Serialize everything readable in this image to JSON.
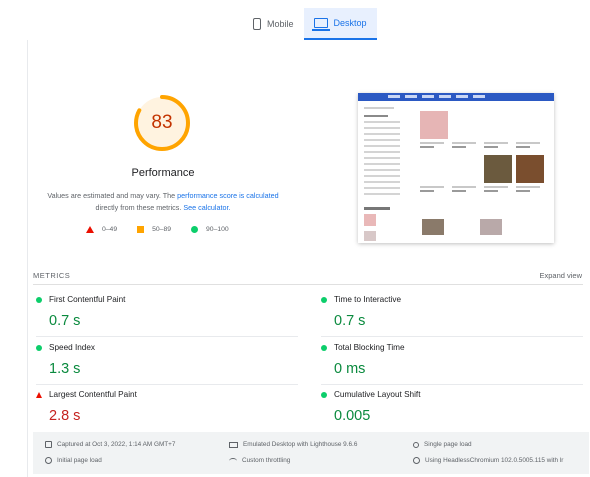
{
  "tabs": [
    {
      "label": "Mobile",
      "icon": "mobile-icon",
      "active": false
    },
    {
      "label": "Desktop",
      "icon": "desktop-icon",
      "active": true
    }
  ],
  "performance": {
    "score": "83",
    "score_fraction": 0.83,
    "score_color": "#ffa400",
    "title": "Performance",
    "desc_part1": "Values are estimated and may vary. The",
    "desc_link1": "performance score is calculated",
    "desc_part2": "directly from these metrics.",
    "desc_link2": "See calculator."
  },
  "legend": [
    {
      "label": "0–49",
      "symbol": "triangle",
      "color": "#eb0f00"
    },
    {
      "label": "50–89",
      "symbol": "square",
      "color": "#ffa400"
    },
    {
      "label": "90–100",
      "symbol": "circle",
      "color": "#0cce6b"
    }
  ],
  "metrics": {
    "header": "METRICS",
    "expand_label": "Expand view",
    "items": [
      {
        "name": "First Contentful Paint",
        "value": "0.7 s",
        "status": "good"
      },
      {
        "name": "Time to Interactive",
        "value": "0.7 s",
        "status": "good"
      },
      {
        "name": "Speed Index",
        "value": "1.3 s",
        "status": "good"
      },
      {
        "name": "Total Blocking Time",
        "value": "0 ms",
        "status": "good"
      },
      {
        "name": "Largest Contentful Paint",
        "value": "2.8 s",
        "status": "poor"
      },
      {
        "name": "Cumulative Layout Shift",
        "value": "0.005",
        "status": "good"
      }
    ]
  },
  "footer": {
    "captured": "Captured at Oct 3, 2022, 1:14 AM GMT+7",
    "initial_load": "Initial page load",
    "emulated": "Emulated Desktop with Lighthouse 9.6.6",
    "throttling": "Custom throttling",
    "single_load": "Single page load",
    "browser": "Using HeadlessChromium 102.0.5005.115 with lr"
  }
}
